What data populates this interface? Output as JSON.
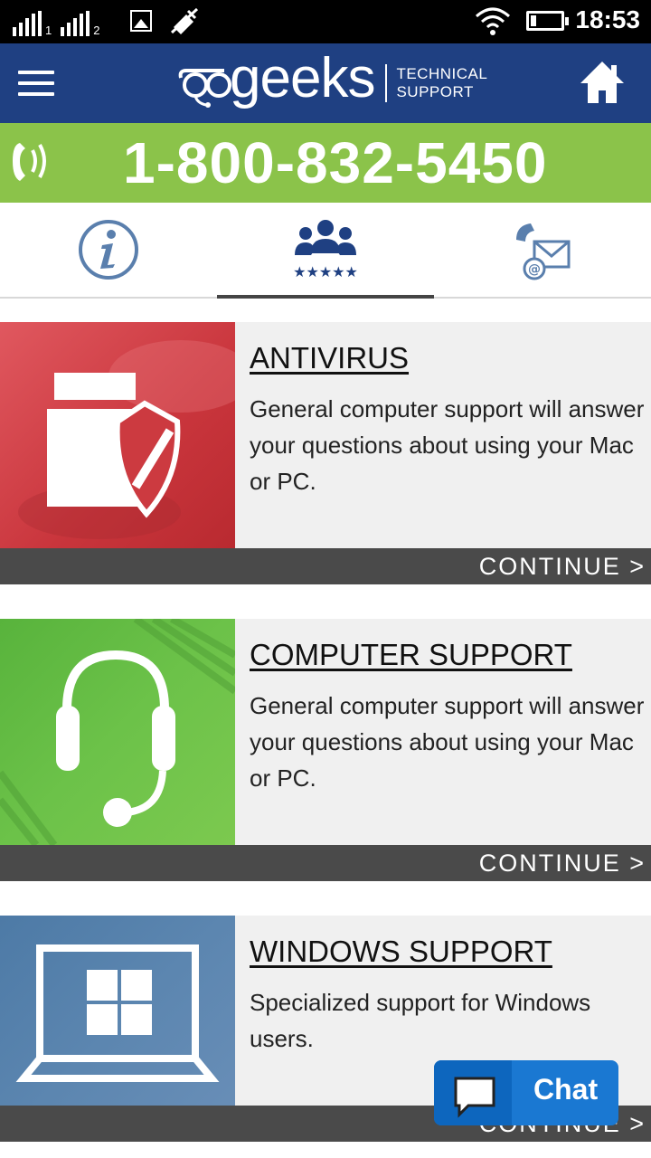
{
  "status_bar": {
    "sim1": "1",
    "sim2": "2",
    "time": "18:53",
    "icons": [
      "signal-icon",
      "signal-icon",
      "image-icon",
      "mute-icon",
      "wifi-icon",
      "battery-icon"
    ]
  },
  "header": {
    "logo_text": "geeks",
    "logo_tag_line1": "TECHNICAL",
    "logo_tag_line2": "SUPPORT",
    "menu_icon": "hamburger-icon",
    "home_icon": "home-icon",
    "color": "#1f4082"
  },
  "phone": {
    "number": "1-800-832-5450",
    "icon": "phone-ringing-icon",
    "color": "#8bc34a"
  },
  "tabs": [
    {
      "icon": "info-icon",
      "active": false
    },
    {
      "icon": "team-rating-icon",
      "active": true
    },
    {
      "icon": "phone-email-icon",
      "active": false
    }
  ],
  "cards": [
    {
      "title": "ANTIVIRUS",
      "description": "General computer support will answer your questions about using your Mac or PC.",
      "cta": "CONTINUE >",
      "icon": "folder-shield-icon",
      "color": "#d9474e"
    },
    {
      "title": "COMPUTER SUPPORT",
      "description": "General computer support will answer your questions about using your Mac or PC.",
      "cta": "CONTINUE >",
      "icon": "headset-icon",
      "color": "#6cbf3f"
    },
    {
      "title": "WINDOWS SUPPORT",
      "description": "Specialized support for Windows users.",
      "cta": "CONTINUE >",
      "icon": "windows-laptop-icon",
      "color": "#5a7fa8"
    }
  ],
  "chat": {
    "label": "Chat",
    "icon": "chat-bubble-icon",
    "color": "#1a78d2"
  }
}
